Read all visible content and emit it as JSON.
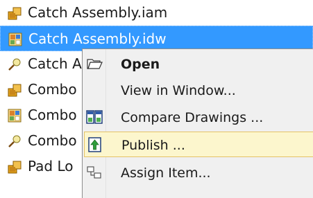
{
  "file_list": {
    "items": [
      {
        "label": "Catch Assembly.iam",
        "icon": "assembly-icon"
      },
      {
        "label": "Catch Assembly.idw",
        "icon": "drawing-icon",
        "selected": true
      },
      {
        "label": "Catch A",
        "icon": "presentation-icon"
      },
      {
        "label": "Combo",
        "icon": "assembly-icon"
      },
      {
        "label": "Combo",
        "icon": "drawing-icon"
      },
      {
        "label": "Combo",
        "icon": "presentation-icon"
      },
      {
        "label": "Pad Lo",
        "icon": "assembly-icon"
      }
    ]
  },
  "context_menu": {
    "items": [
      {
        "label": "Open",
        "icon": "open-folder-icon",
        "bold": true
      },
      {
        "label": "View in Window...",
        "icon": null
      },
      {
        "label": "Compare Drawings ...",
        "icon": "compare-drawings-icon"
      },
      {
        "label": "Publish ...",
        "icon": "publish-icon",
        "highlighted": true
      },
      {
        "label": "Assign Item...",
        "icon": "assign-item-icon"
      }
    ]
  },
  "colors": {
    "selection": "#3399ff",
    "menu_background": "#f0f0f0",
    "menu_highlight": "#fcf6cd",
    "menu_highlight_border": "#e5c365"
  }
}
